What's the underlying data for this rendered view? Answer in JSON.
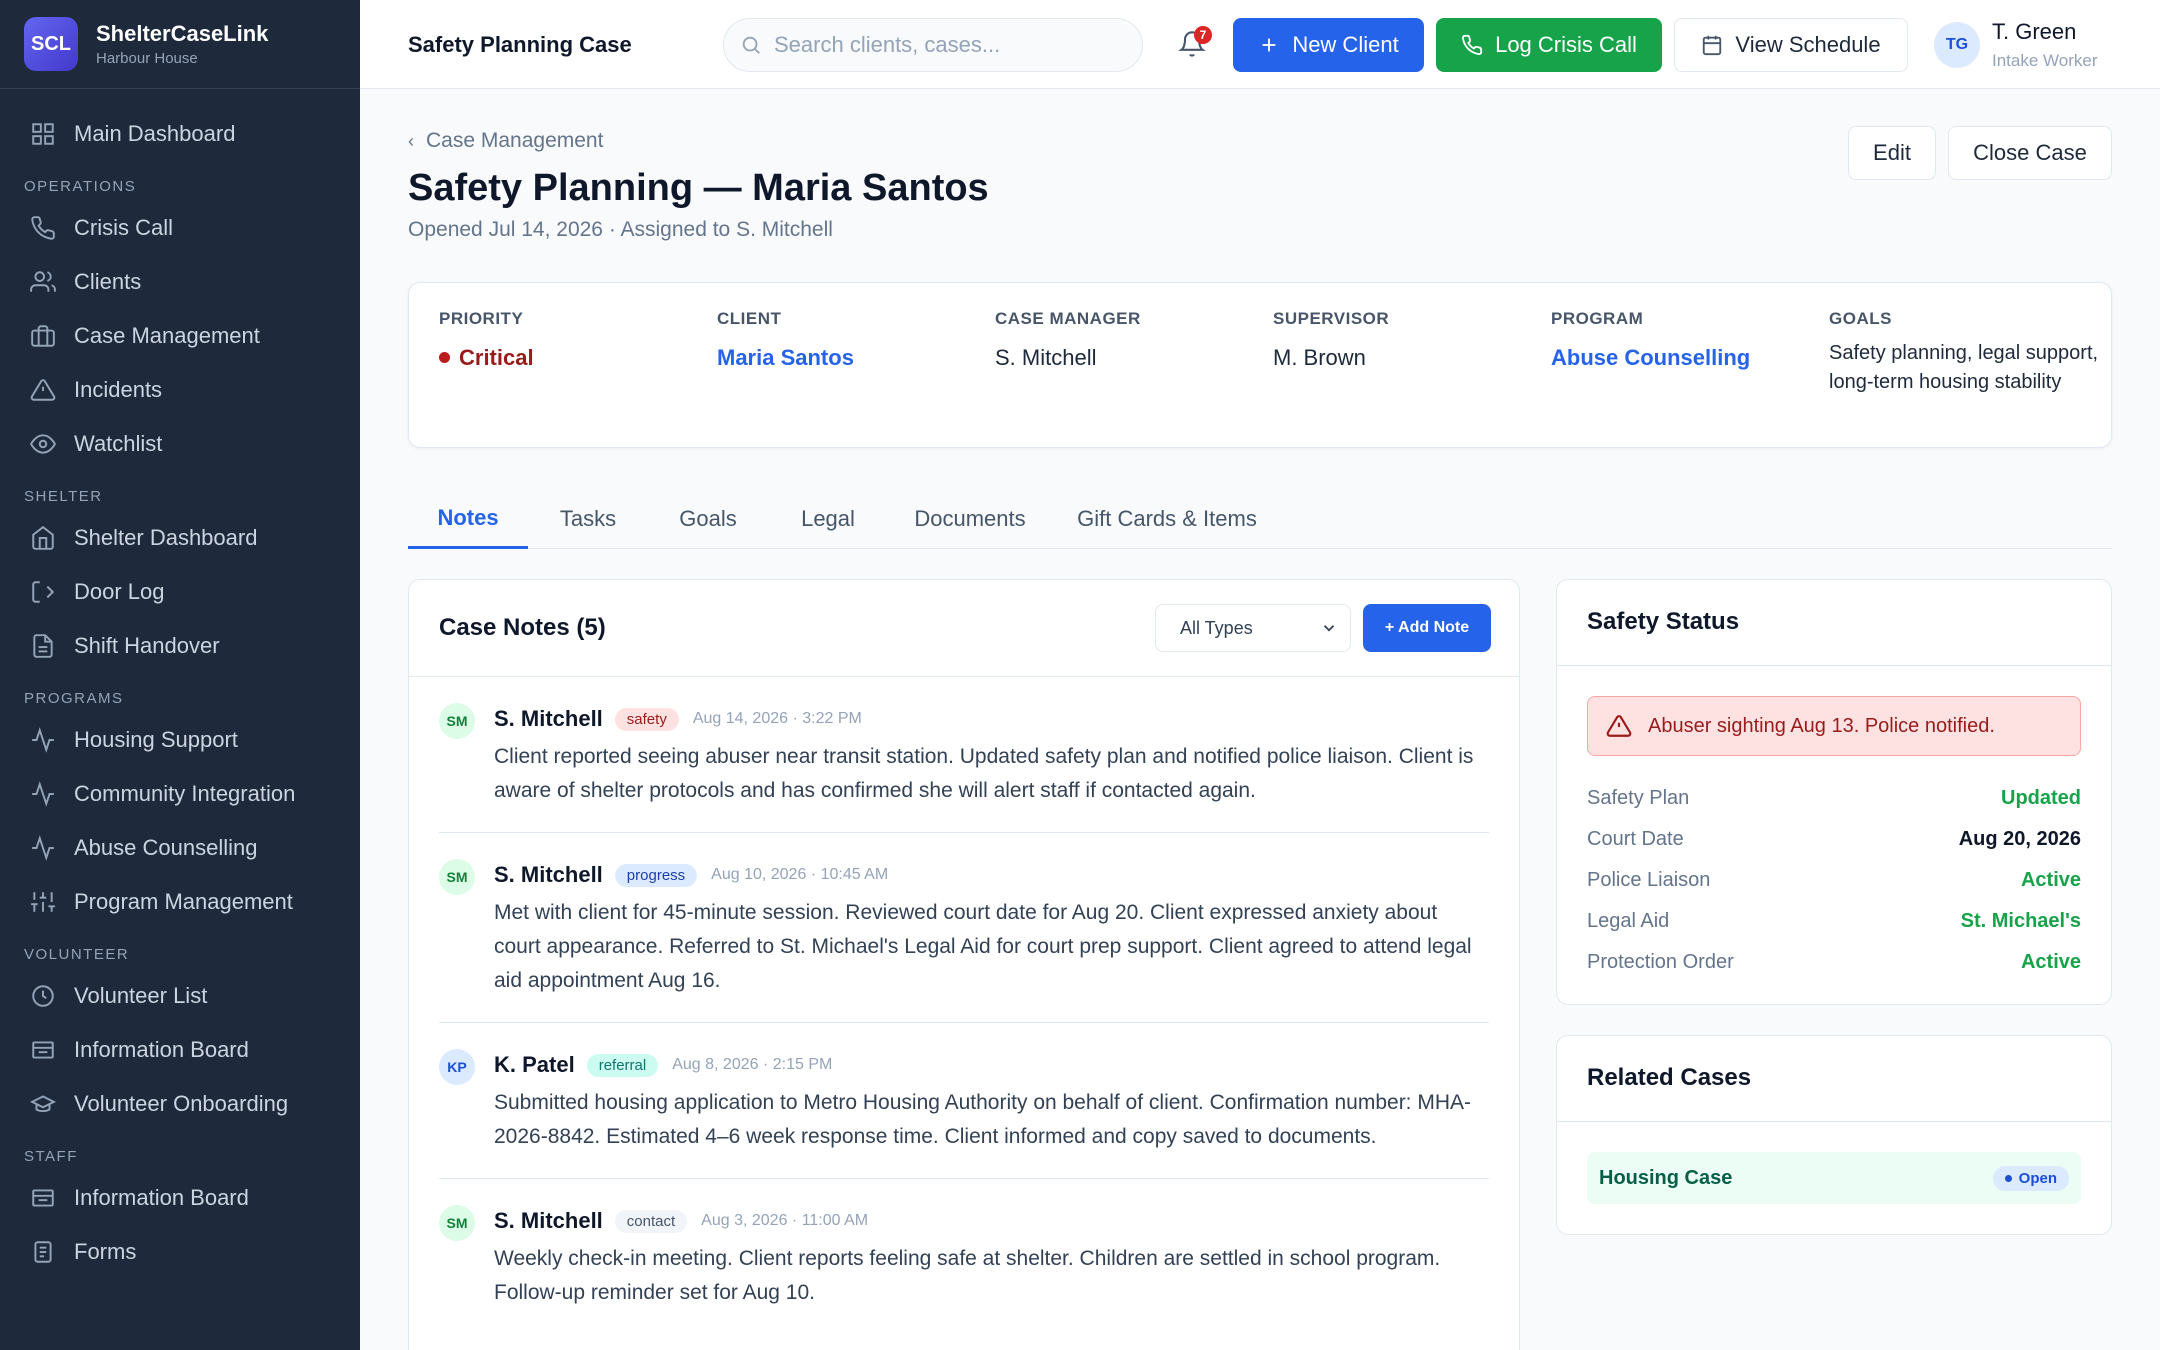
{
  "brand": {
    "logo": "SCL",
    "name": "ShelterCaseLink",
    "org": "Harbour House"
  },
  "sidebar": {
    "top": [
      {
        "label": "Main Dashboard",
        "icon": "grid-icon"
      }
    ],
    "sections": [
      {
        "title": "OPERATIONS",
        "items": [
          {
            "label": "Crisis Call",
            "icon": "phone-icon"
          },
          {
            "label": "Clients",
            "icon": "users-icon"
          },
          {
            "label": "Case Management",
            "icon": "briefcase-icon"
          },
          {
            "label": "Incidents",
            "icon": "warning-icon"
          },
          {
            "label": "Watchlist",
            "icon": "eye-icon"
          }
        ]
      },
      {
        "title": "SHELTER",
        "items": [
          {
            "label": "Shelter Dashboard",
            "icon": "home-icon"
          },
          {
            "label": "Door Log",
            "icon": "door-icon"
          },
          {
            "label": "Shift Handover",
            "icon": "document-icon"
          }
        ]
      },
      {
        "title": "PROGRAMS",
        "items": [
          {
            "label": "Housing Support",
            "icon": "activity-icon"
          },
          {
            "label": "Community Integration",
            "icon": "activity-icon"
          },
          {
            "label": "Abuse Counselling",
            "icon": "activity-icon"
          },
          {
            "label": "Program Management",
            "icon": "sliders-icon"
          }
        ]
      },
      {
        "title": "VOLUNTEER",
        "items": [
          {
            "label": "Volunteer List",
            "icon": "clock-icon"
          },
          {
            "label": "Information Board",
            "icon": "board-icon"
          },
          {
            "label": "Volunteer Onboarding",
            "icon": "graduation-icon"
          }
        ]
      },
      {
        "title": "STAFF",
        "items": [
          {
            "label": "Information Board",
            "icon": "board-icon"
          },
          {
            "label": "Forms",
            "icon": "form-icon"
          }
        ]
      }
    ]
  },
  "topbar": {
    "title": "Safety Planning Case",
    "search_placeholder": "Search clients, cases...",
    "notification_count": "7",
    "new_client": "New Client",
    "log_crisis": "Log Crisis Call",
    "view_schedule": "View Schedule",
    "user_initials": "TG",
    "user_name": "T. Green",
    "user_role": "Intake Worker"
  },
  "page": {
    "breadcrumb": "Case Management",
    "title": "Safety Planning — Maria Santos",
    "subtitle": "Opened Jul 14, 2026 · Assigned to S. Mitchell",
    "edit": "Edit",
    "close_case": "Close Case"
  },
  "info": {
    "priority_label": "PRIORITY",
    "priority": "Critical",
    "client_label": "CLIENT",
    "client": "Maria Santos",
    "manager_label": "CASE MANAGER",
    "manager": "S. Mitchell",
    "supervisor_label": "SUPERVISOR",
    "supervisor": "M. Brown",
    "program_label": "PROGRAM",
    "program": "Abuse Counselling",
    "goals_label": "GOALS",
    "goals": "Safety planning, legal support, long-term housing stability"
  },
  "tabs": [
    "Notes",
    "Tasks",
    "Goals",
    "Legal",
    "Documents",
    "Gift Cards & Items"
  ],
  "notes": {
    "title": "Case Notes (5)",
    "filter": "All Types",
    "add": "+ Add Note",
    "items": [
      {
        "initials": "SM",
        "author": "S. Mitchell",
        "tag": "safety",
        "date": "Aug 14, 2026 · 3:22 PM",
        "text": "Client reported seeing abuser near transit station. Updated safety plan and notified police liaison. Client is aware of shelter protocols and has confirmed she will alert staff if contacted again."
      },
      {
        "initials": "SM",
        "author": "S. Mitchell",
        "tag": "progress",
        "date": "Aug 10, 2026 · 10:45 AM",
        "text": "Met with client for 45-minute session. Reviewed court date for Aug 20. Client expressed anxiety about court appearance. Referred to St. Michael's Legal Aid for court prep support. Client agreed to attend legal aid appointment Aug 16."
      },
      {
        "initials": "KP",
        "author": "K. Patel",
        "tag": "referral",
        "date": "Aug 8, 2026 · 2:15 PM",
        "text": "Submitted housing application to Metro Housing Authority on behalf of client. Confirmation number: MHA-2026-8842. Estimated 4–6 week response time. Client informed and copy saved to documents."
      },
      {
        "initials": "SM",
        "author": "S. Mitchell",
        "tag": "contact",
        "date": "Aug 3, 2026 · 11:00 AM",
        "text": "Weekly check-in meeting. Client reports feeling safe at shelter. Children are settled in school program. Follow-up reminder set for Aug 10."
      }
    ]
  },
  "safety": {
    "title": "Safety Status",
    "alert": "Abuser sighting Aug 13. Police notified.",
    "rows": [
      {
        "label": "Safety Plan",
        "value": "Updated"
      },
      {
        "label": "Court Date",
        "value": "Aug 20, 2026"
      },
      {
        "label": "Police Liaison",
        "value": "Active"
      },
      {
        "label": "Legal Aid",
        "value": "St. Michael's"
      },
      {
        "label": "Protection Order",
        "value": "Active"
      }
    ]
  },
  "related": {
    "title": "Related Cases",
    "item": "Housing Case",
    "status": "Open"
  }
}
